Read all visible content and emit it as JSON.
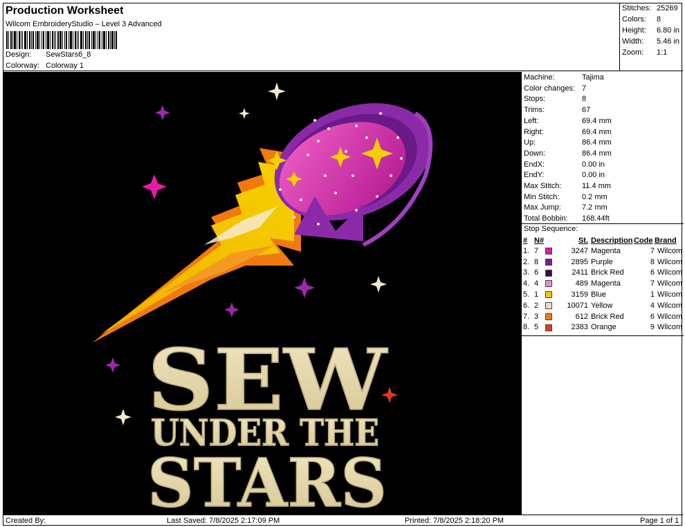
{
  "header": {
    "title": "Production Worksheet",
    "subtitle": "Wilcom EmbroideryStudio – Level 3 Advanced",
    "design_label": "Design:",
    "design_value": "SewStars6_8",
    "colorway_label": "Colorway:",
    "colorway_value": "Colorway 1"
  },
  "summary": [
    {
      "label": "Stitches:",
      "value": "25269"
    },
    {
      "label": "Colors:",
      "value": "8"
    },
    {
      "label": "Height:",
      "value": "6.80 in"
    },
    {
      "label": "Width:",
      "value": "5.46 in"
    },
    {
      "label": "Zoom:",
      "value": "1:1"
    }
  ],
  "machine_info": [
    {
      "label": "Machine:",
      "value": "Tajima"
    },
    {
      "label": "Color changes:",
      "value": "7"
    },
    {
      "label": "Stops:",
      "value": "8"
    },
    {
      "label": "Trims:",
      "value": "67"
    },
    {
      "label": "Left:",
      "value": "69.4 mm"
    },
    {
      "label": "Right:",
      "value": "69.4 mm"
    },
    {
      "label": "Up:",
      "value": "86.4 mm"
    },
    {
      "label": "Down:",
      "value": "86.4 mm"
    },
    {
      "label": "EndX:",
      "value": "0.00 in"
    },
    {
      "label": "EndY:",
      "value": "0.00 in"
    },
    {
      "label": "Max Stitch:",
      "value": "11.4 mm"
    },
    {
      "label": "Min Stitch:",
      "value": "0.2 mm"
    },
    {
      "label": "Max Jump:",
      "value": "7.2 mm"
    },
    {
      "label": "Total Bobbin:",
      "value": "168.44ft"
    }
  ],
  "stop_sequence": {
    "label": "Stop Sequence:",
    "headers": [
      "#",
      "N#",
      "St.",
      "Description",
      "Code",
      "Brand"
    ],
    "rows": [
      {
        "idx": "1.",
        "n": "7",
        "color": "#d81bb0",
        "st": "3247",
        "desc": "Magenta",
        "code": "7",
        "brand": "Wilcom"
      },
      {
        "idx": "2.",
        "n": "8",
        "color": "#7a1e8c",
        "st": "2895",
        "desc": "Purple",
        "code": "8",
        "brand": "Wilcom"
      },
      {
        "idx": "3.",
        "n": "6",
        "color": "#3a0e3e",
        "st": "2411",
        "desc": "Brick Red",
        "code": "6",
        "brand": "Wilcom"
      },
      {
        "idx": "4.",
        "n": "4",
        "color": "#e88ad0",
        "st": "489",
        "desc": "Magenta",
        "code": "7",
        "brand": "Wilcom"
      },
      {
        "idx": "5.",
        "n": "1",
        "color": "#f5c400",
        "st": "3159",
        "desc": "Blue",
        "code": "1",
        "brand": "Wilcom"
      },
      {
        "idx": "6.",
        "n": "2",
        "color": "#f3dcc0",
        "st": "10071",
        "desc": "Yellow",
        "code": "4",
        "brand": "Wilcom"
      },
      {
        "idx": "7.",
        "n": "3",
        "color": "#f07a10",
        "st": "612",
        "desc": "Brick Red",
        "code": "6",
        "brand": "Wilcom"
      },
      {
        "idx": "8.",
        "n": "5",
        "color": "#e03a1a",
        "st": "2383",
        "desc": "Orange",
        "code": "9",
        "brand": "Wilcom"
      }
    ]
  },
  "artwork": {
    "line1": "SEW",
    "line2": "UNDER THE",
    "line3": "STARS",
    "text_color": "#e8dbb0",
    "comet_color": "#d81bb0",
    "rim_color": "#8a2aa8",
    "flame_color": "#f5c400",
    "flame_edge_color": "#f07a10"
  },
  "footer": {
    "created_by": "Created By:",
    "last_saved": "Last Saved: 7/8/2025 2:17:09 PM",
    "printed": "Printed: 7/8/2025 2:18:20 PM",
    "page": "Page 1 of 1"
  }
}
